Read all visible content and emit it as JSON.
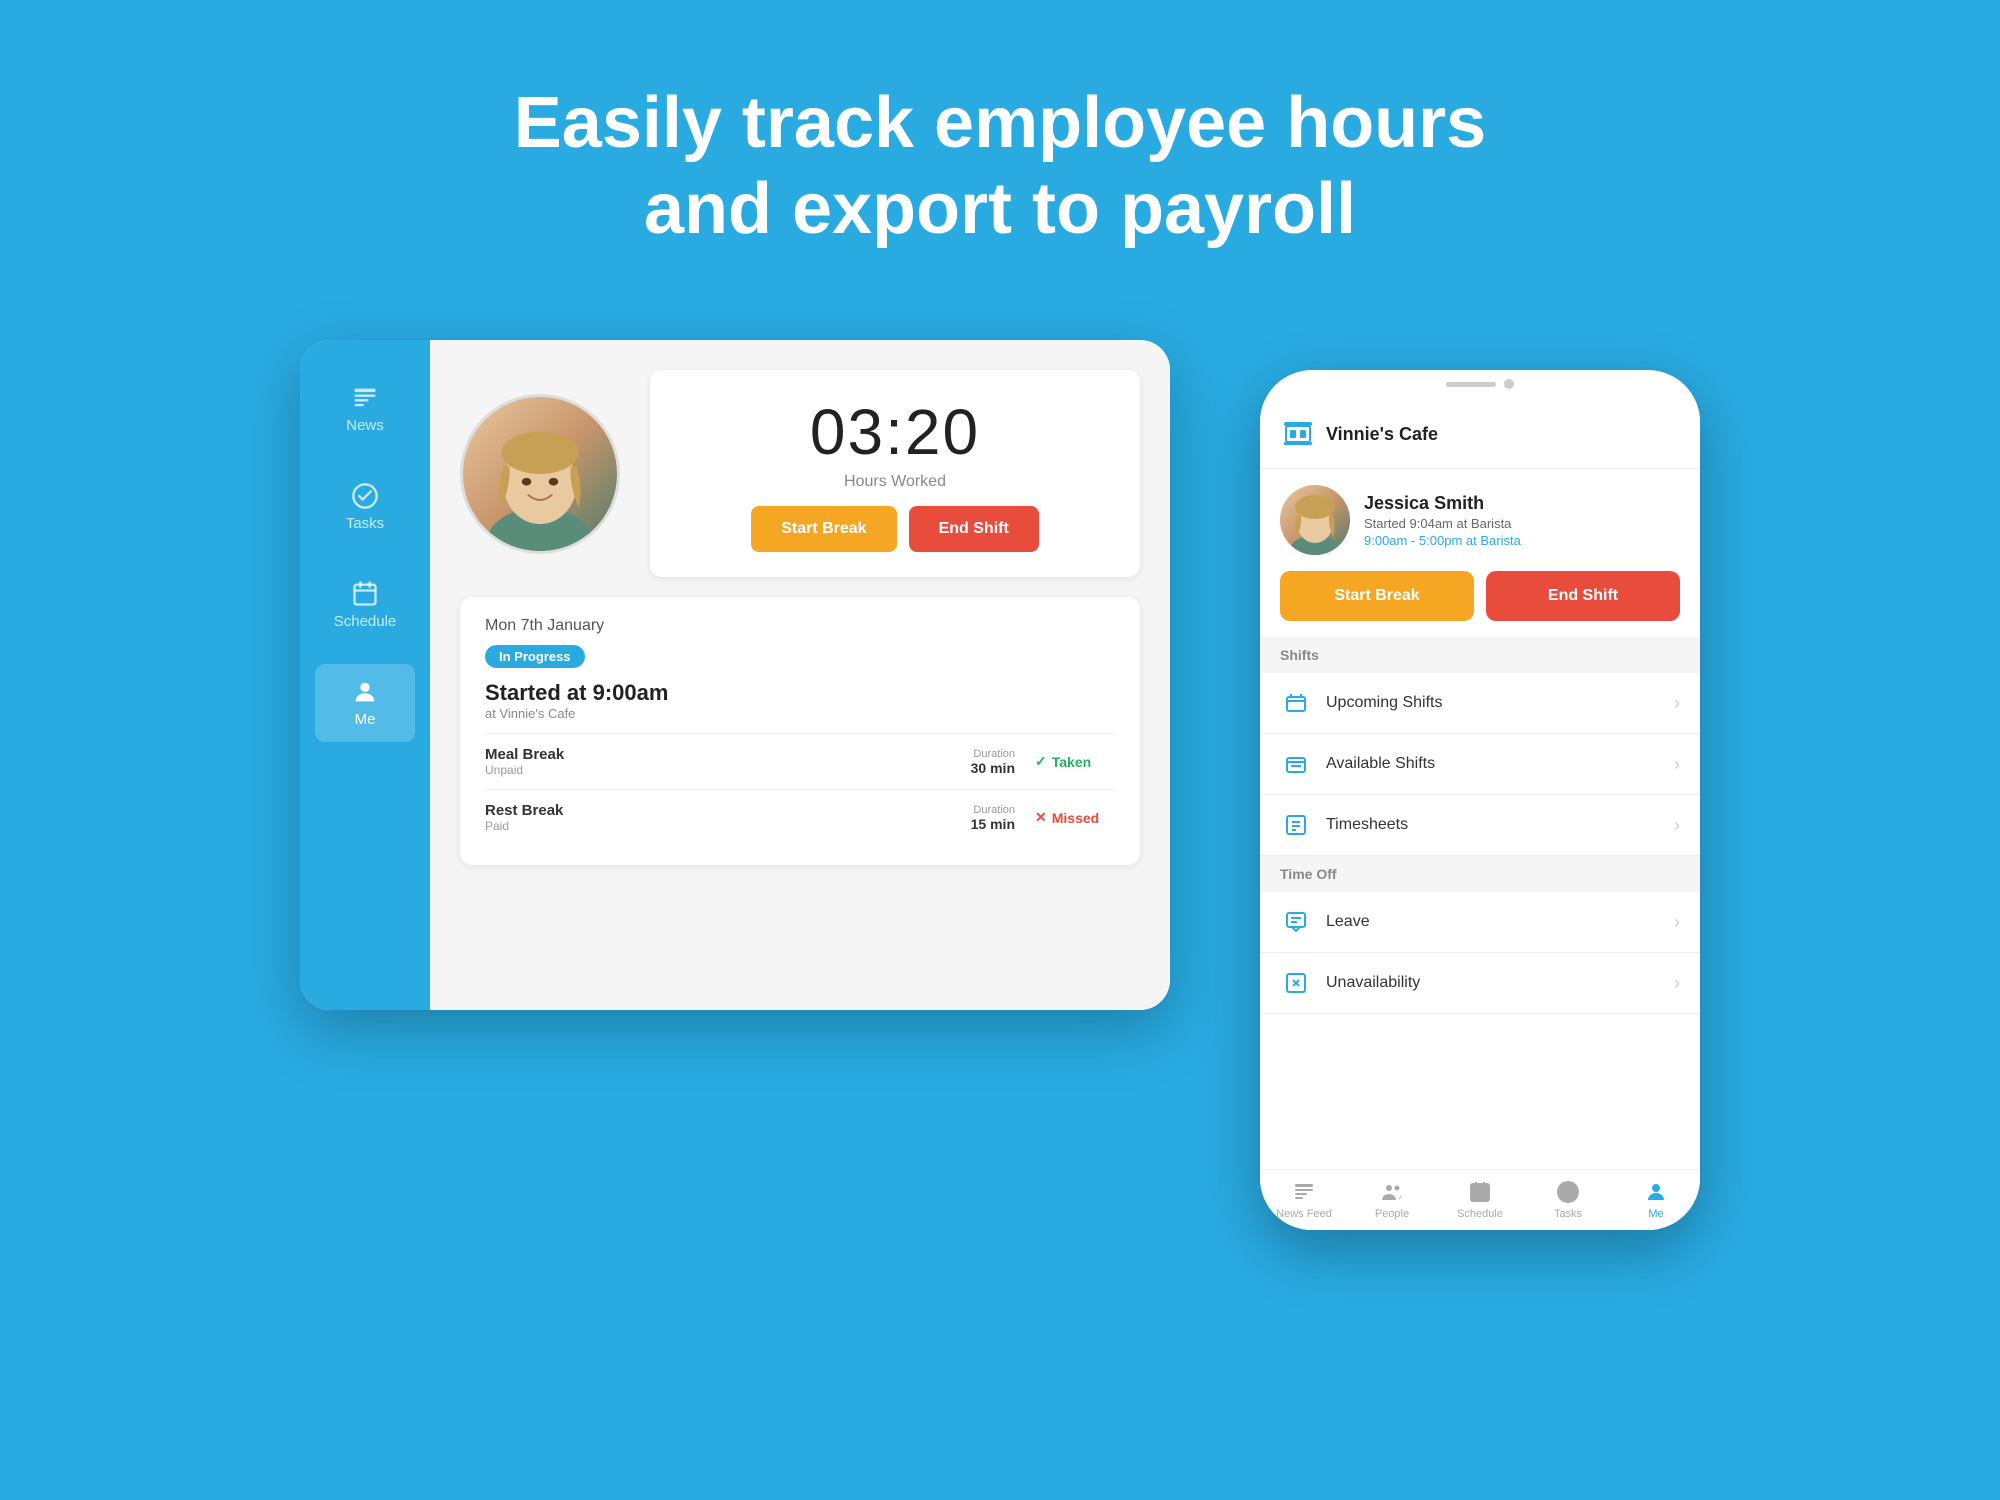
{
  "headline": {
    "line1": "Easily track employee hours",
    "line2": "and export to payroll"
  },
  "tablet": {
    "sidebar": {
      "items": [
        {
          "id": "news",
          "label": "News"
        },
        {
          "id": "tasks",
          "label": "Tasks"
        },
        {
          "id": "schedule",
          "label": "Schedule"
        },
        {
          "id": "me",
          "label": "Me"
        }
      ],
      "active": "me"
    },
    "timer": {
      "time": "03:20",
      "label": "Hours Worked"
    },
    "buttons": {
      "start_break": "Start Break",
      "end_shift": "End Shift"
    },
    "shift": {
      "date": "Mon 7th January",
      "badge": "In Progress",
      "started": "Started at 9:00am",
      "location": "at Vinnie's Cafe",
      "breaks": [
        {
          "name": "Meal Break",
          "type": "Unpaid",
          "duration_label": "Duration",
          "duration": "30 min",
          "status": "Taken",
          "status_type": "taken"
        },
        {
          "name": "Rest Break",
          "type": "Paid",
          "duration_label": "Duration",
          "duration": "15 min",
          "status": "Missed",
          "status_type": "missed"
        }
      ]
    }
  },
  "phone": {
    "header": {
      "title": "Vinnie's Cafe"
    },
    "user": {
      "name": "Jessica Smith",
      "started": "Started 9:04am at Barista",
      "shift": "9:00am - 5:00pm at Barista"
    },
    "buttons": {
      "start_break": "Start Break",
      "end_shift": "End Shift"
    },
    "sections": [
      {
        "title": "Shifts",
        "items": [
          {
            "id": "upcoming",
            "label": "Upcoming Shifts"
          },
          {
            "id": "available",
            "label": "Available Shifts"
          },
          {
            "id": "timesheets",
            "label": "Timesheets"
          }
        ]
      },
      {
        "title": "Time Off",
        "items": [
          {
            "id": "leave",
            "label": "Leave"
          },
          {
            "id": "unavailability",
            "label": "Unavailability"
          }
        ]
      }
    ],
    "bottom_nav": [
      {
        "id": "news-feed",
        "label": "News Feed"
      },
      {
        "id": "people",
        "label": "People"
      },
      {
        "id": "schedule",
        "label": "Schedule"
      },
      {
        "id": "tasks",
        "label": "Tasks"
      },
      {
        "id": "me",
        "label": "Me"
      }
    ],
    "active_nav": "me"
  }
}
